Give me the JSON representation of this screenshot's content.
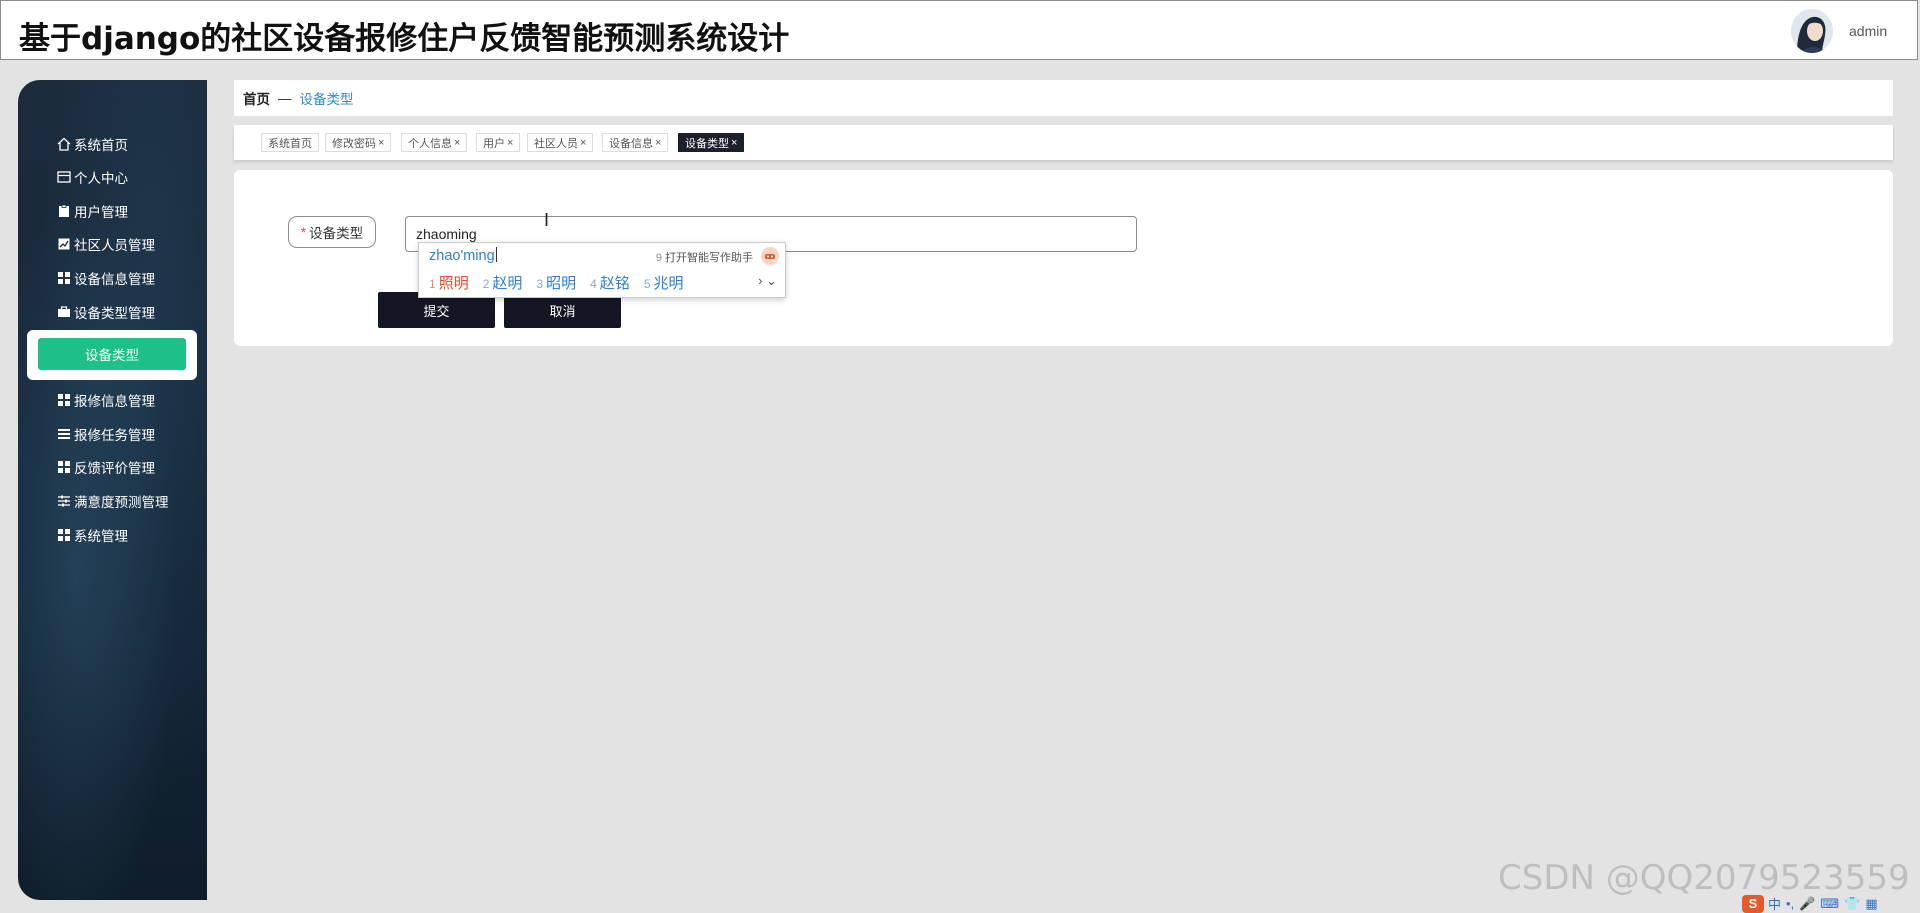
{
  "header": {
    "title": "基于django的社区设备报修住户反馈智能预测系统设计",
    "username": "admin"
  },
  "sidebar": {
    "items": [
      {
        "label": "系统首页",
        "icon": "home-icon"
      },
      {
        "label": "个人中心",
        "icon": "id-card-icon"
      },
      {
        "label": "用户管理",
        "icon": "clipboard-icon"
      },
      {
        "label": "社区人员管理",
        "icon": "chart-icon"
      },
      {
        "label": "设备信息管理",
        "icon": "grid-icon"
      },
      {
        "label": "设备类型管理",
        "icon": "briefcase-icon"
      },
      {
        "label": "报修信息管理",
        "icon": "grid-icon"
      },
      {
        "label": "报修任务管理",
        "icon": "list-icon"
      },
      {
        "label": "反馈评价管理",
        "icon": "grid-icon"
      },
      {
        "label": "满意度预测管理",
        "icon": "sliders-icon"
      },
      {
        "label": "系统管理",
        "icon": "grid-icon"
      }
    ],
    "active_sub": "设备类型"
  },
  "breadcrumb": {
    "home": "首页",
    "separator": "—",
    "current": "设备类型"
  },
  "tabs": [
    {
      "label": "系统首页",
      "closable": false
    },
    {
      "label": "修改密码",
      "closable": true
    },
    {
      "label": "个人信息",
      "closable": true
    },
    {
      "label": "用户",
      "closable": true
    },
    {
      "label": "社区人员",
      "closable": true
    },
    {
      "label": "设备信息",
      "closable": true
    },
    {
      "label": "设备类型",
      "closable": true,
      "active": true
    }
  ],
  "form": {
    "required_mark": "*",
    "label": "设备类型",
    "value": "zhaoming",
    "submit": "提交",
    "cancel": "取消"
  },
  "ime": {
    "composition": "zhao'ming",
    "assist_num": "9",
    "assist_label": "打开智能写作助手",
    "candidates": [
      {
        "n": "1",
        "text": "照明"
      },
      {
        "n": "2",
        "text": "赵明"
      },
      {
        "n": "3",
        "text": "昭明"
      },
      {
        "n": "4",
        "text": "赵铭"
      },
      {
        "n": "5",
        "text": "兆明"
      }
    ],
    "nav": "› ⌄"
  },
  "watermark": "CSDN @QQ2079523559",
  "tray": {
    "logo": "S",
    "lang": "中",
    "punct": "•,",
    "mic": "🎤",
    "keyboard": "⌨",
    "skin": "👕",
    "apps": "▦"
  },
  "colors": {
    "accent_green": "#1ec089",
    "dark_button": "#141626",
    "link_blue": "#2f8bc9"
  }
}
